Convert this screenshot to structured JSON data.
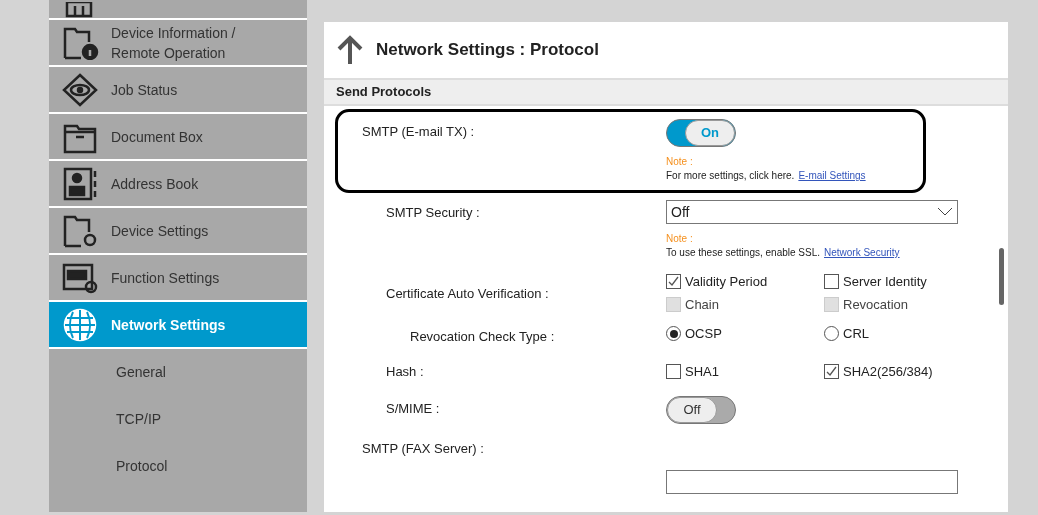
{
  "sidebar": {
    "items": [
      {
        "kind": "home",
        "selected": false
      },
      {
        "kind": "device-info",
        "label": "Device Information /\nRemote Operation",
        "selected": false
      },
      {
        "kind": "eye",
        "label": "Job Status",
        "selected": false
      },
      {
        "kind": "folder",
        "label": "Document Box",
        "selected": false
      },
      {
        "kind": "address",
        "label": "Address Book",
        "selected": false
      },
      {
        "kind": "device-settings",
        "label": "Device Settings",
        "selected": false
      },
      {
        "kind": "function-settings",
        "label": "Function Settings",
        "selected": false
      },
      {
        "kind": "globe",
        "label": "Network Settings",
        "selected": true,
        "children": [
          {
            "label": "General"
          },
          {
            "label": "TCP/IP"
          },
          {
            "label": "Protocol"
          }
        ]
      }
    ]
  },
  "page": {
    "title": "Network Settings : Protocol",
    "section": "Send Protocols",
    "rows": [
      {
        "kind": "toggle",
        "label": "SMTP (E-mail TX) :",
        "value": "On",
        "on": true,
        "highlighted": true,
        "note": {
          "title": "Note :",
          "text": "For more settings, click here.",
          "link": "E-mail Settings"
        },
        "children": [
          {
            "kind": "select",
            "label": "SMTP Security :",
            "value": "Off",
            "note": {
              "title": "Note :",
              "text": "To use these settings, enable SSL.",
              "link": "Network Security"
            }
          },
          {
            "kind": "checkboxes",
            "label": "Certificate Auto Verification :",
            "options": [
              {
                "label": "Validity Period",
                "checked": true,
                "disabled": false
              },
              {
                "label": "Server Identity",
                "checked": false,
                "disabled": false
              },
              {
                "label": "Chain",
                "checked": false,
                "disabled": true
              },
              {
                "label": "Revocation",
                "checked": false,
                "disabled": true
              }
            ],
            "children": [
              {
                "kind": "radio",
                "label": "Revocation Check Type :",
                "options": [
                  {
                    "label": "OCSP",
                    "selected": true
                  },
                  {
                    "label": "CRL",
                    "selected": false
                  }
                ]
              }
            ]
          },
          {
            "kind": "checkboxes",
            "label": "Hash :",
            "options": [
              {
                "label": "SHA1",
                "checked": false,
                "disabled": false
              },
              {
                "label": "SHA2(256/384)",
                "checked": true,
                "disabled": false
              }
            ]
          },
          {
            "kind": "toggle",
            "label": "S/MIME :",
            "value": "Off",
            "on": false
          }
        ]
      },
      {
        "kind": "heading",
        "label": "SMTP (FAX Server) :"
      },
      {
        "kind": "blank-field"
      }
    ]
  }
}
